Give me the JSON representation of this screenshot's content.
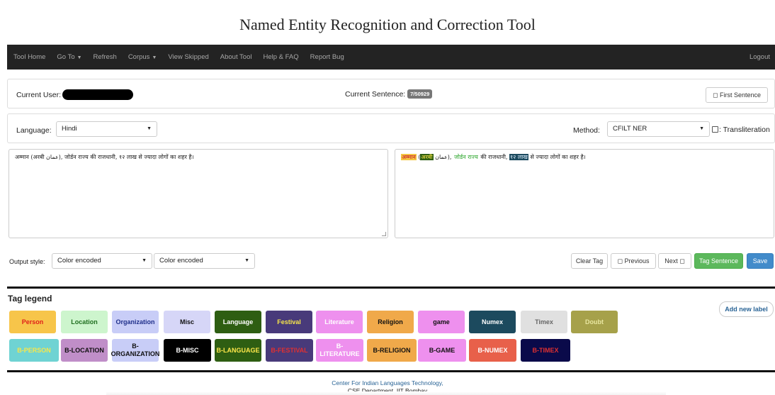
{
  "title": "Named Entity Recognition and Correction Tool",
  "navbar": {
    "items": [
      "Tool Home",
      "Go To",
      "Refresh",
      "Corpus",
      "View Skipped",
      "About Tool",
      "Help & FAQ",
      "Report Bug"
    ],
    "dropdown_items": [
      "Go To",
      "Corpus"
    ],
    "logout": "Logout"
  },
  "user_panel": {
    "current_user_label": "Current User:",
    "current_sentence_label": "Current Sentence:",
    "current_sentence_value": "7/50929",
    "first_sentence_label": "◻ First Sentence"
  },
  "language_panel": {
    "language_label": "Language:",
    "language_value": "Hindi",
    "method_label": "Method:",
    "method_value": "CFILT NER",
    "transliteration_label": ": Transliteration"
  },
  "input_text": "अम्मान (अरबी عمان), जोर्डन राज्य की राजधानी, १२ लाख से ज्यादा लोगों का शहर है।",
  "output_text": {
    "person": "अम्मान",
    "open": " (",
    "language": "अरबी",
    "arabic": " عمان",
    "close": "), ",
    "location": "जोर्डन राज्य",
    "mid": " की राजधानी, ",
    "numex": "१२ लाख",
    "rest": " से ज्यादा लोगों का शहर है।"
  },
  "controls": {
    "output_style_label": "Output style:",
    "output_style_1": "Color encoded",
    "output_style_2": "Color encoded",
    "clear_tag": "Clear Tag",
    "previous": "◻ Previous",
    "next": "Next ◻",
    "tag_sentence": "Tag Sentence",
    "save": "Save"
  },
  "legend": {
    "title": "Tag legend",
    "add_new_label": "Add new label",
    "row1": [
      {
        "label": "Person",
        "bg": "#f7c54a",
        "fg": "#e0201a"
      },
      {
        "label": "Location",
        "bg": "#cdf5cd",
        "fg": "#1f6e1f"
      },
      {
        "label": "Organization",
        "bg": "#c8cdf7",
        "fg": "#1f2f8a"
      },
      {
        "label": "Misc",
        "bg": "#d6d6f7",
        "fg": "#111111"
      },
      {
        "label": "Language",
        "bg": "#2e5e12",
        "fg": "#ffffff"
      },
      {
        "label": "Festival",
        "bg": "#483a7a",
        "fg": "#f7e64a"
      },
      {
        "label": "Literature",
        "bg": "#ee90ee",
        "fg": "#ffffff"
      },
      {
        "label": "Religion",
        "bg": "#f0a94a",
        "fg": "#111111"
      },
      {
        "label": "game",
        "bg": "#ee90ee",
        "fg": "#111111"
      },
      {
        "label": "Numex",
        "bg": "#1c4a5e",
        "fg": "#ffffff"
      },
      {
        "label": "Timex",
        "bg": "#e0e0e0",
        "fg": "#666666"
      },
      {
        "label": "Doubt",
        "bg": "#a6a14a",
        "fg": "#e8e6a0"
      }
    ],
    "row2": [
      {
        "label": "B-PERSON",
        "bg": "#6fd3d3",
        "fg": "#f7e64a"
      },
      {
        "label": "B-LOCATION",
        "bg": "#c08ec8",
        "fg": "#111111"
      },
      {
        "label": "B-ORGANIZATION",
        "bg": "#c8cdf7",
        "fg": "#111111"
      },
      {
        "label": "B-MISC",
        "bg": "#000000",
        "fg": "#ffffff"
      },
      {
        "label": "B-LANGUAGE",
        "bg": "#2e5e12",
        "fg": "#ffe84a"
      },
      {
        "label": "B-FESTIVAL",
        "bg": "#483a7a",
        "fg": "#e03030"
      },
      {
        "label": "B-LITERATURE",
        "bg": "#ee90ee",
        "fg": "#ffffff"
      },
      {
        "label": "B-RELIGION",
        "bg": "#f0a94a",
        "fg": "#111111"
      },
      {
        "label": "B-GAME",
        "bg": "#ee90ee",
        "fg": "#111111"
      },
      {
        "label": "B-NUMEX",
        "bg": "#e8604a",
        "fg": "#ffffff"
      },
      {
        "label": "B-TIMEX",
        "bg": "#0a0a4a",
        "fg": "#e03030"
      }
    ]
  },
  "footer": {
    "line1": "Center For Indian Languages Technology,",
    "line2": "CSE Department, IIT Bombay"
  }
}
